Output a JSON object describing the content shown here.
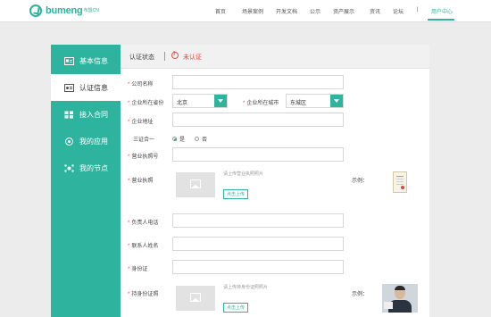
{
  "header": {
    "logo_text": "bumeng",
    "logo_sub": "布盟CN",
    "nav": [
      "首页",
      "场景案例",
      "开发文档",
      "公示",
      "资产展示",
      "资讯",
      "论坛",
      "|",
      "用户中心"
    ],
    "active": "用户中心"
  },
  "sidebar": {
    "items": [
      {
        "label": "基本信息",
        "icon": "id-card-icon"
      },
      {
        "label": "认证信息",
        "icon": "certificate-icon"
      },
      {
        "label": "接入合同",
        "icon": "contract-icon"
      },
      {
        "label": "我的应用",
        "icon": "apps-icon"
      },
      {
        "label": "我的节点",
        "icon": "node-icon"
      }
    ],
    "active_index": 1
  },
  "status": {
    "label": "认证状态",
    "value": "未认证"
  },
  "form": {
    "company_name": {
      "label": "公司名称",
      "value": ""
    },
    "province": {
      "label": "企业所在省份",
      "value": "北京"
    },
    "city": {
      "label": "企业所在城市",
      "value": "东城区"
    },
    "address": {
      "label": "企业地址",
      "value": ""
    },
    "three_in_one": {
      "label": "三证合一",
      "options": [
        "是",
        "否"
      ],
      "selected": "是"
    },
    "license_no": {
      "label": "营业执照号",
      "value": ""
    },
    "license_photo": {
      "label": "营业执照",
      "hint": "请上传营业执照照片",
      "button": "点击上传"
    },
    "manager_phone": {
      "label": "负责人电话",
      "value": ""
    },
    "contact_name": {
      "label": "联系人姓名",
      "value": ""
    },
    "id_card": {
      "label": "身份证",
      "value": ""
    },
    "id_photo": {
      "label": "持身份证照",
      "hint": "请上传持身份证照照片",
      "button": "点击上传"
    },
    "example_label": "示例："
  },
  "colors": {
    "accent": "#2db39e",
    "error": "#e74c3c"
  }
}
